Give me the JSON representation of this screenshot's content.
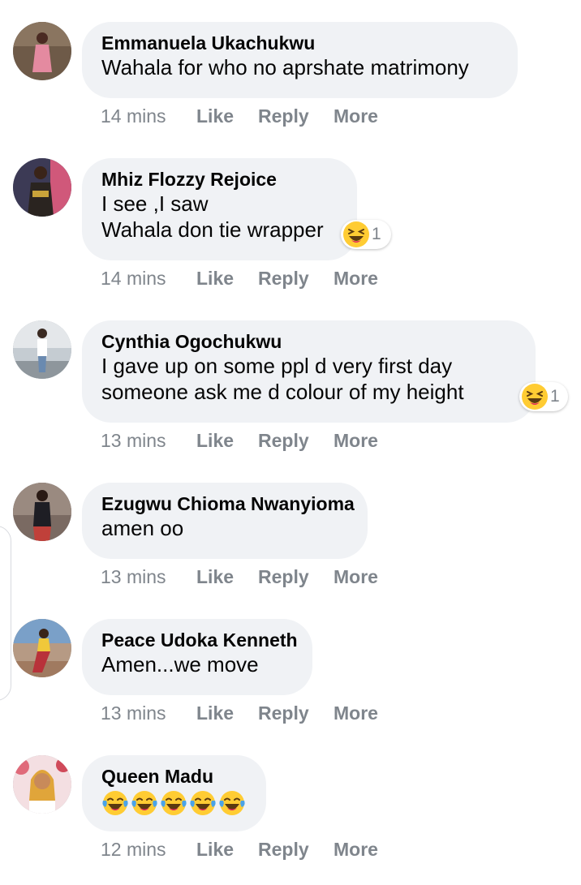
{
  "comments": [
    {
      "author": "Emmanuela Ukachukwu",
      "text": "Wahala for who no aprshate matrimony",
      "time": "14 mins",
      "avatar_colors": [
        "#7a4a3a",
        "#d88a9a"
      ],
      "reaction": null
    },
    {
      "author": "Mhiz Flozzy Rejoice",
      "text": "I see ,I saw\nWahala don tie wrapper",
      "time": "14 mins",
      "avatar_colors": [
        "#3a3550",
        "#b8962a"
      ],
      "reaction": {
        "icon": "grinning-squinting-face-icon",
        "count": "1"
      }
    },
    {
      "author": "Cynthia Ogochukwu",
      "text": "I gave up on some ppl d very first day\nsomeone ask me d colour of my height",
      "time": "13 mins",
      "avatar_colors": [
        "#b9c2c9",
        "#eef0f2"
      ],
      "reaction": {
        "icon": "grinning-squinting-face-icon",
        "count": "1"
      }
    },
    {
      "author": "Ezugwu Chioma Nwanyioma",
      "text": "amen oo",
      "time": "13 mins",
      "avatar_colors": [
        "#6a5a52",
        "#2a2a30"
      ],
      "reaction": null
    },
    {
      "author": "Peace Udoka Kenneth",
      "text": "Amen...we move",
      "time": "13 mins",
      "avatar_colors": [
        "#c9a68a",
        "#b8323a"
      ],
      "reaction": null
    },
    {
      "author": "Queen Madu",
      "text": "",
      "emoji_text": [
        "face-with-tears-of-joy-icon",
        "face-with-tears-of-joy-icon",
        "face-with-tears-of-joy-icon",
        "face-with-tears-of-joy-icon",
        "face-with-tears-of-joy-icon"
      ],
      "time": "12 mins",
      "avatar_colors": [
        "#f3d9dc",
        "#d9a03a"
      ],
      "reaction": null
    }
  ],
  "actions": {
    "like": "Like",
    "reply": "Reply",
    "more": "More"
  },
  "colors": {
    "bubble": "#f0f2f5",
    "meta": "#7f858c",
    "emoji_face": "#ffcc33",
    "tongue": "#e0245e"
  }
}
